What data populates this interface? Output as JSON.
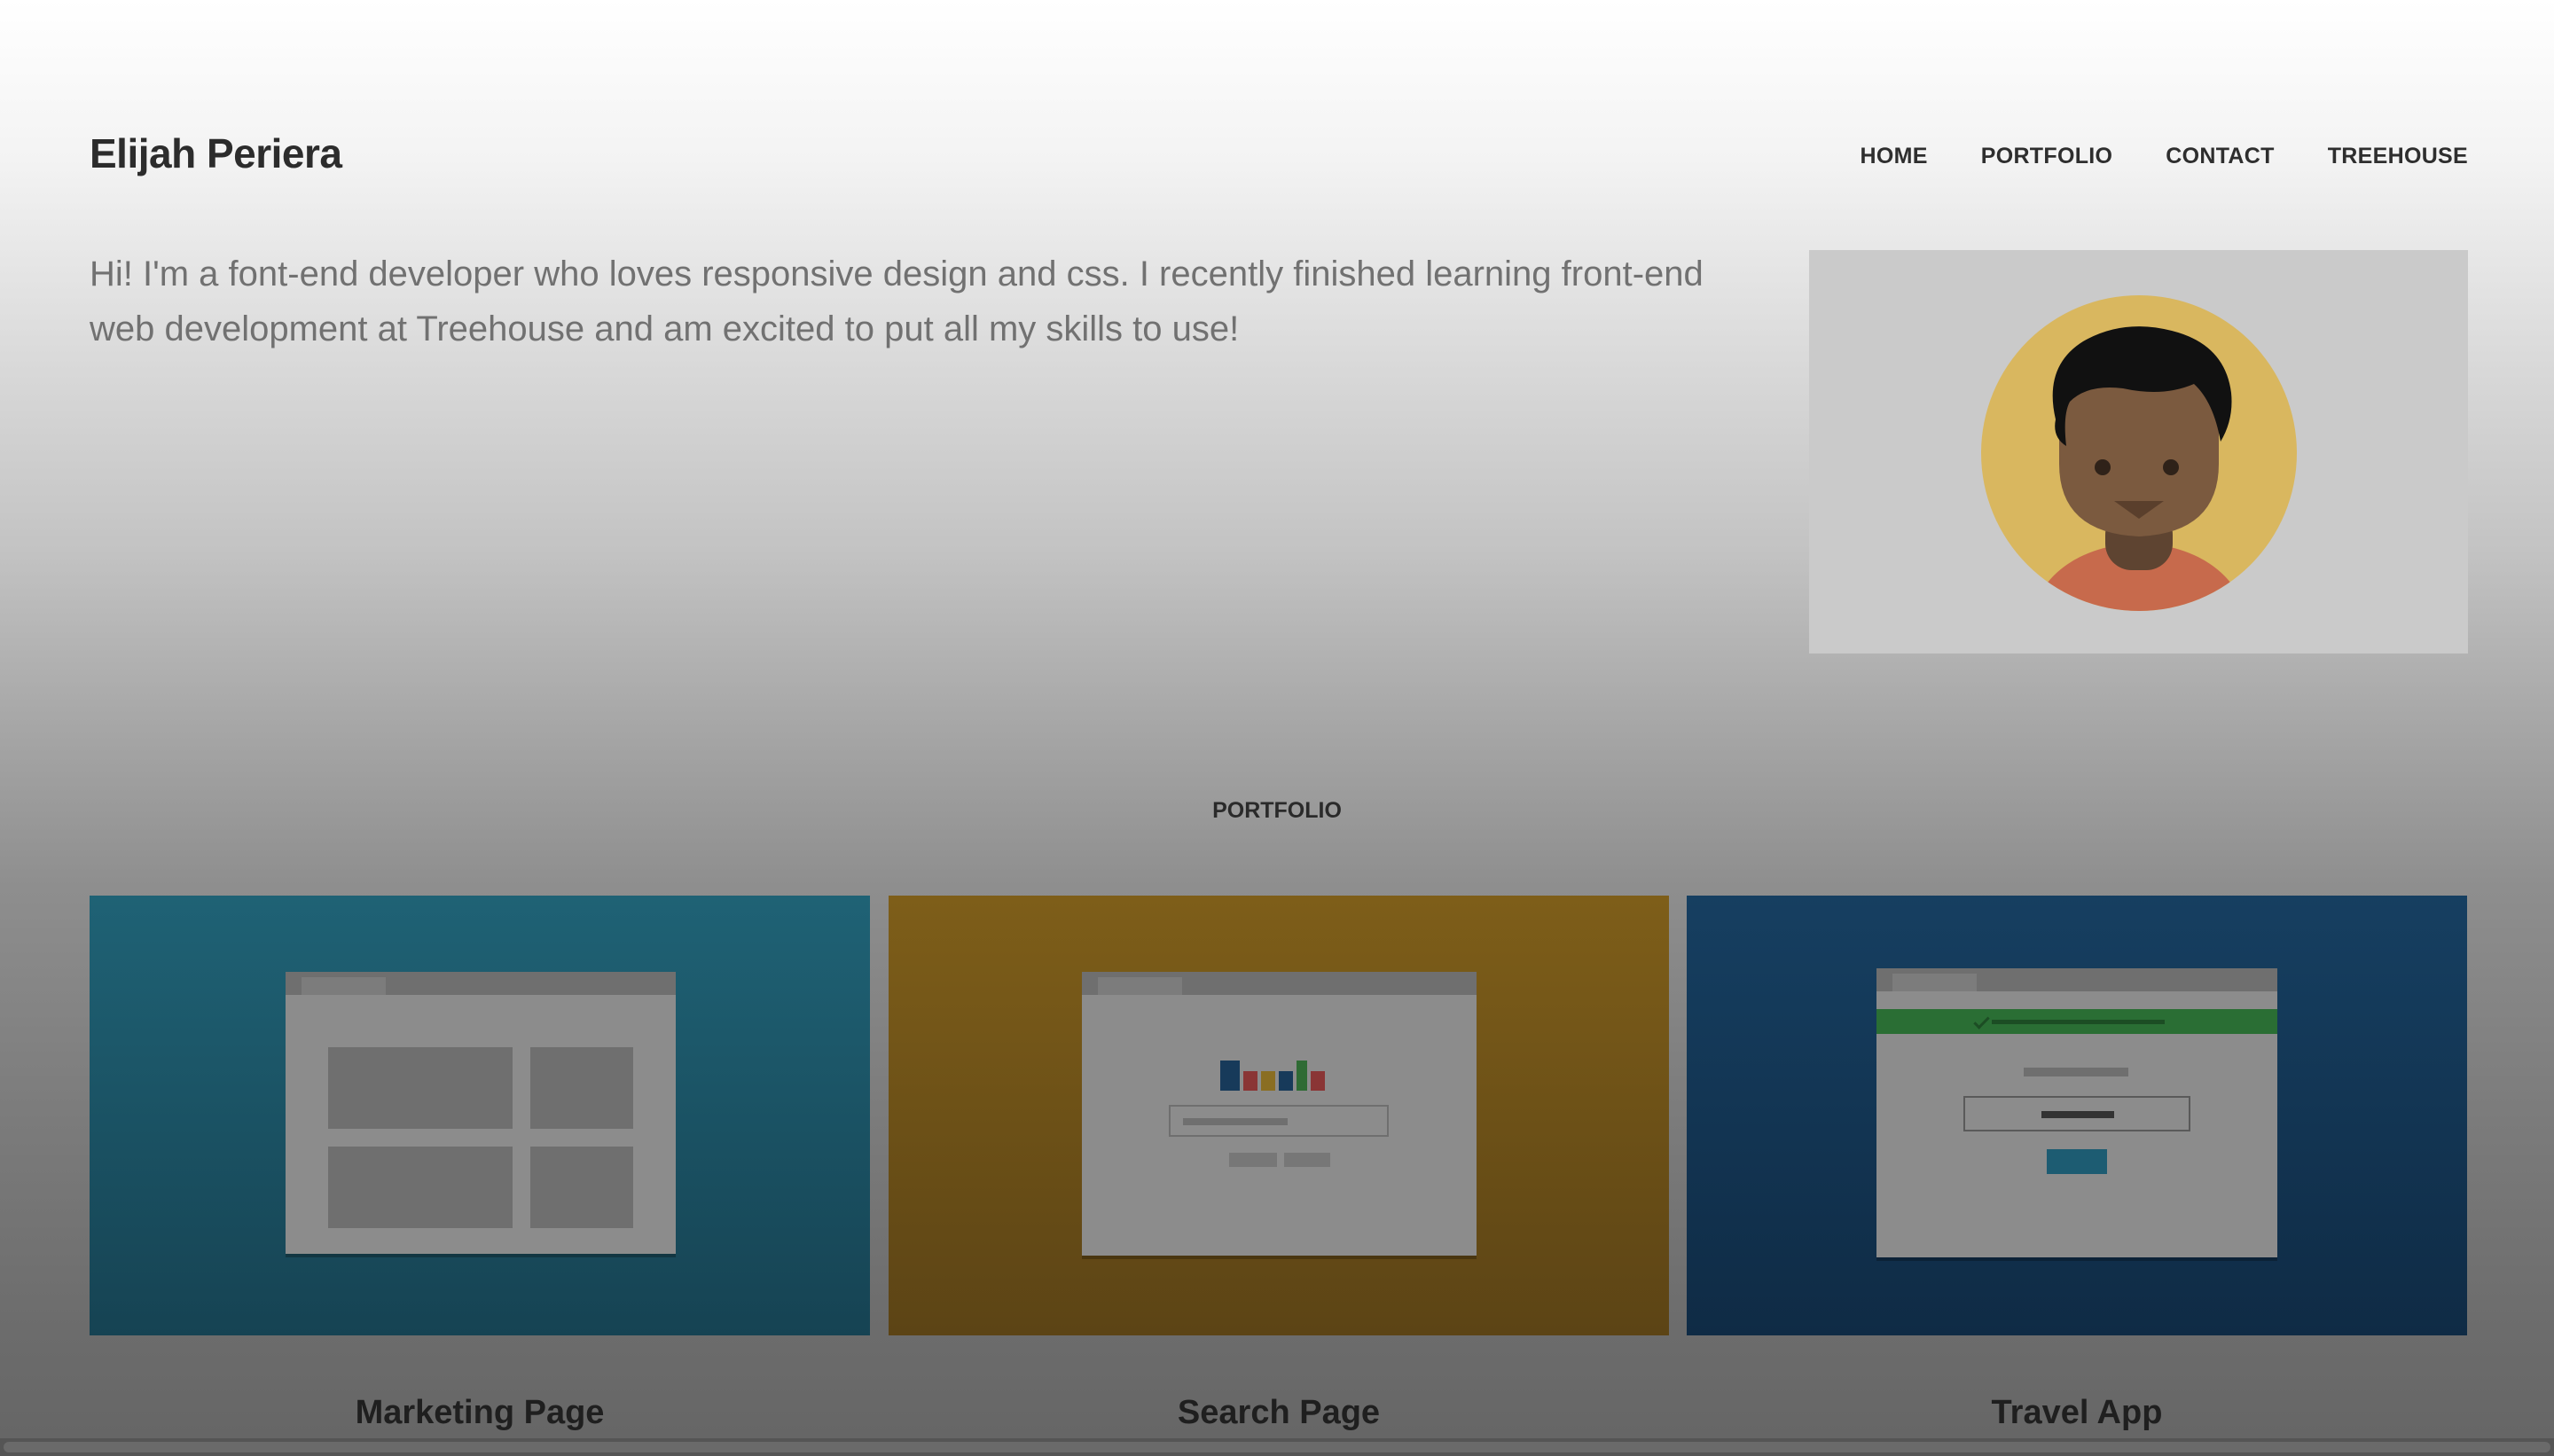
{
  "header": {
    "title": "Elijah Periera",
    "nav": [
      {
        "label": "HOME"
      },
      {
        "label": "PORTFOLIO"
      },
      {
        "label": "CONTACT"
      },
      {
        "label": "TREEHOUSE"
      }
    ]
  },
  "intro": {
    "text": "Hi! I'm a font-end developer who loves responsive design and css. I recently finished learning front-end web development at Treehouse and am excited to put all my skills to use!"
  },
  "avatar": {
    "icon": "developer-avatar-icon"
  },
  "portfolio": {
    "section_title": "PORTFOLIO",
    "projects": [
      {
        "title": "Marketing Page",
        "color": "#1f6275"
      },
      {
        "title": "Search Page",
        "color": "#7e5e19"
      },
      {
        "title": "Travel App",
        "color": "#163f61"
      }
    ]
  }
}
